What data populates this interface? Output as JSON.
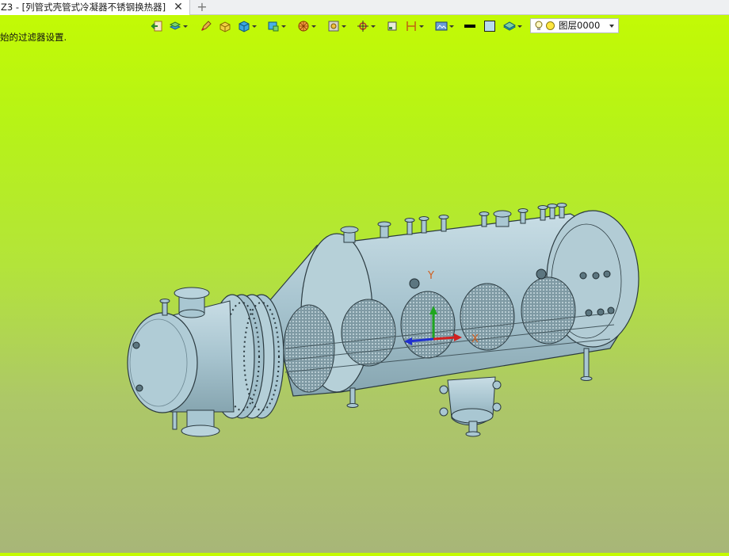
{
  "tab": {
    "title": "Z3 - [列管式壳管式冷凝器不锈钢换热器]",
    "close_glyph": "✕",
    "add_glyph": "+"
  },
  "prompt_text": "始的过滤器设置.",
  "toolbar": {
    "buttons": [
      {
        "name": "exit-sketch-icon",
        "dropdown": false
      },
      {
        "name": "layers-stack-icon",
        "dropdown": true
      },
      {
        "name": "pen-sketch-icon",
        "dropdown": false
      },
      {
        "name": "solid-block-icon",
        "dropdown": false
      },
      {
        "name": "cube-shaded-icon",
        "dropdown": true
      },
      {
        "name": "view-box-icon",
        "dropdown": true
      },
      {
        "name": "render-sphere-icon",
        "dropdown": true
      },
      {
        "name": "frame-display-icon",
        "dropdown": true
      },
      {
        "name": "crosshair-locate-icon",
        "dropdown": true
      },
      {
        "name": "square-select-icon",
        "dropdown": false
      },
      {
        "name": "dimension-bracket-icon",
        "dropdown": true
      },
      {
        "name": "display-mode-icon",
        "dropdown": true
      },
      {
        "name": "line-weight-icon",
        "dropdown": false
      },
      {
        "name": "color-swatch-icon",
        "dropdown": false
      },
      {
        "name": "layer-plane-icon",
        "dropdown": true
      }
    ],
    "layer": {
      "value": "图层0000"
    }
  },
  "colors": {
    "tab_bg": "#ffffff",
    "background_top": "#c4fb02",
    "background_bottom": "#a8b678",
    "model_fill": "#a9c7d2",
    "model_edge": "#2b3a40"
  },
  "model": {
    "label": "列管式壳管式冷凝器不锈钢换热器",
    "axis_x_label": "X",
    "axis_y_label": "Y"
  }
}
